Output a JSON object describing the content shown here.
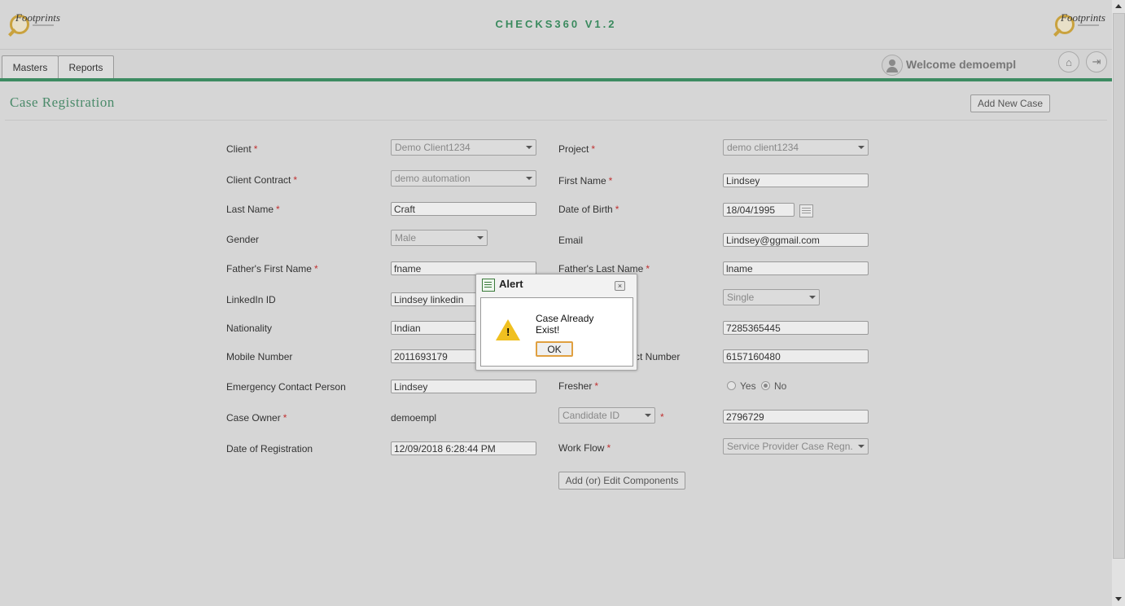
{
  "app": {
    "title": "CHECKS360 V1.2",
    "logo_text": "Footprints"
  },
  "nav": {
    "tabs": [
      {
        "label": "Masters"
      },
      {
        "label": "Reports"
      }
    ],
    "welcome": "Welcome demoempl"
  },
  "page": {
    "title": "Case Registration",
    "add_new_case": "Add New Case"
  },
  "form": {
    "client": {
      "label": "Client",
      "value": "Demo Client1234"
    },
    "project": {
      "label": "Project",
      "value": "demo client1234"
    },
    "client_contract": {
      "label": "Client Contract",
      "value": "demo automation"
    },
    "first_name": {
      "label": "First Name",
      "value": "Lindsey"
    },
    "last_name": {
      "label": "Last Name",
      "value": "Craft"
    },
    "dob": {
      "label": "Date of Birth",
      "value": "18/04/1995"
    },
    "gender": {
      "label": "Gender",
      "value": "Male"
    },
    "email": {
      "label": "Email",
      "value": "Lindsey@ggmail.com"
    },
    "father_first": {
      "label": "Father's First Name",
      "value": "fname"
    },
    "father_last": {
      "label": "Father's Last Name",
      "value": "lname"
    },
    "linkedin": {
      "label": "LinkedIn ID",
      "value": "Lindsey linkedin"
    },
    "marital_status": {
      "value": "Single"
    },
    "nationality": {
      "label": "Nationality",
      "value": "Indian"
    },
    "right_phone": {
      "value": "7285365445"
    },
    "mobile": {
      "label": "Mobile Number",
      "value": "2011693179"
    },
    "emergency_number": {
      "label_partial": "ct Number",
      "value": "6157160480"
    },
    "emergency_person": {
      "label": "Emergency Contact Person",
      "value": "Lindsey"
    },
    "fresher": {
      "label": "Fresher",
      "yes": "Yes",
      "no": "No"
    },
    "case_owner": {
      "label": "Case Owner",
      "value": "demoempl"
    },
    "candidate_id": {
      "select": "Candidate ID",
      "value": "2796729"
    },
    "date_of_registration": {
      "label": "Date of Registration",
      "value": "12/09/2018 6:28:44 PM"
    },
    "workflow": {
      "label": "Work Flow",
      "value": "Service Provider Case Regn."
    },
    "add_components": "Add (or) Edit Components",
    "required_mark": "*"
  },
  "dialog": {
    "title": "Alert",
    "message": "Case Already Exist!",
    "ok": "OK",
    "close": "×"
  }
}
